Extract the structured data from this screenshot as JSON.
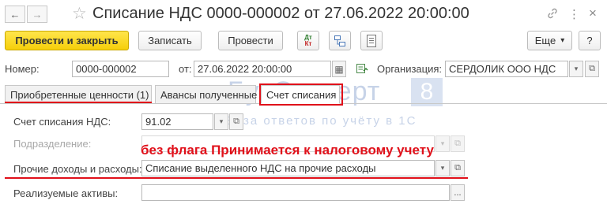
{
  "window": {
    "title": "Списание НДС 0000-000002 от 27.06.2022 20:00:00",
    "back_icon": "←",
    "forward_icon": "→",
    "star_icon": "☆",
    "link_icon": "🔗",
    "menu_icon": "⋮",
    "close_icon": "×"
  },
  "toolbar": {
    "post_and_close": "Провести и закрыть",
    "save": "Записать",
    "post": "Провести",
    "dt_kt_top": "Дт",
    "dt_kt_bottom": "Кт",
    "more": "Еще",
    "more_arrow": "▾",
    "help": "?"
  },
  "header": {
    "number_label": "Номер:",
    "number_value": "0000-000002",
    "date_label": "от:",
    "date_value": "27.06.2022 20:00:00",
    "org_label": "Организация:",
    "org_value": "СЕРДОЛИК ООО НДС"
  },
  "tabs": [
    {
      "label": "Приобретенные ценности (1)"
    },
    {
      "label": "Авансы полученные"
    },
    {
      "label": "Счет списания"
    }
  ],
  "form": {
    "vat_account_label": "Счет списания НДС:",
    "vat_account_value": "91.02",
    "subdivision_label": "Подразделение:",
    "other_income_label": "Прочие доходы и расходы:",
    "other_income_value": "Списание выделенного НДС на прочие расходы",
    "assets_label": "Реализуемые активы:",
    "assets_button": "..."
  },
  "annotation": "без флага Принимается к налоговому учету",
  "watermark": {
    "brand": "БухЭксперт",
    "number": "8",
    "tagline": "База ответов по учёту в 1С"
  },
  "glyphs": {
    "dropdown": "▾",
    "open": "⧉",
    "calendar": "▦"
  },
  "colors": {
    "primary_button": "#f6cf0a",
    "annotation_red": "#e0101a",
    "watermark": "#c7d3e8"
  }
}
